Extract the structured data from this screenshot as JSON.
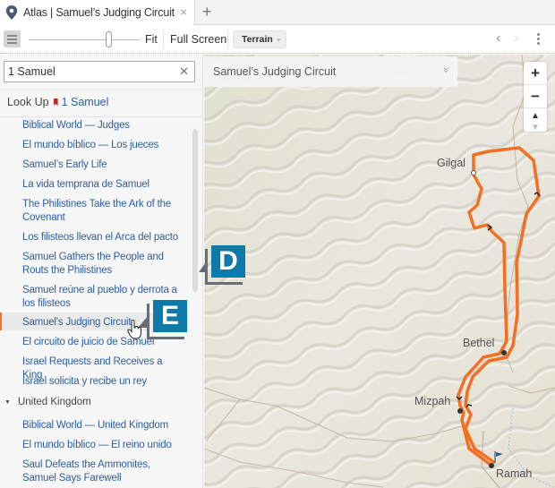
{
  "tab": {
    "title": "Atlas | Samuel’s Judging Circuit",
    "close_label": "×",
    "new_tab_label": "+",
    "icon": "map-pin-icon"
  },
  "toolbar": {
    "fit_label": "Fit",
    "fullscreen_label": "Full Screen",
    "terrain_label": "Terrain",
    "zoom_slider_value": 0.72
  },
  "sidebar": {
    "search_value": "1 Samuel",
    "lookup_label": "Look Up",
    "lookup_link": "1 Samuel",
    "items": [
      {
        "label": "Biblical World — Judges"
      },
      {
        "label": "El mundo bíblico — Los jueces"
      },
      {
        "label": "Samuel’s Early Life"
      },
      {
        "label": "La vida temprana de Samuel"
      },
      {
        "label": "The Philistines Take the Ark of the Covenant"
      },
      {
        "label": "Los filisteos llevan el Arca del pacto"
      },
      {
        "label": "Samuel Gathers the People and Routs the Philistines"
      },
      {
        "label": "Samuel reúne al pueblo y derrota a los filisteos"
      },
      {
        "label": "Samuel's Judging Circuit",
        "selected": true
      },
      {
        "label": "El circuito de juicio de Samuel"
      },
      {
        "label": "Israel Requests and Receives a King"
      },
      {
        "label": "Israel solicita y recibe un rey"
      }
    ],
    "group": {
      "label": "United Kingdom",
      "expanded": true
    },
    "group_items": [
      {
        "label": "Biblical World — United Kingdom"
      },
      {
        "label": "El mundo bíblico — El reino unido"
      },
      {
        "label": "Saul Defeats the Ammonites, Samuel Says Farewell"
      }
    ]
  },
  "map": {
    "header_title": "Samuel’s Judging Circuit",
    "zoom_in": "+",
    "zoom_out": "−",
    "compass": "▲",
    "route_color": "#f36f21",
    "places": [
      "Gilgal",
      "Bethel",
      "Mizpah",
      "Ramah"
    ]
  },
  "callouts": {
    "d": "D",
    "e": "E",
    "color": "#0e7aaa"
  }
}
